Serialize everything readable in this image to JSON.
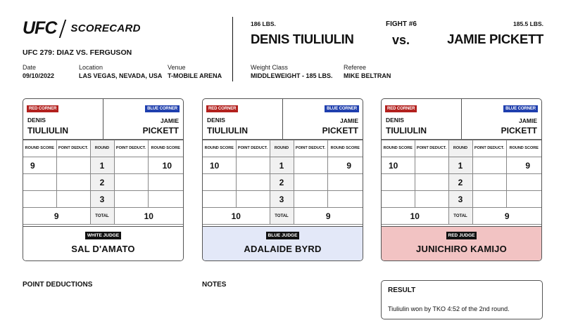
{
  "brand": {
    "logo": "UFC",
    "section": "SCORECARD"
  },
  "event": {
    "name": "UFC 279: DIAZ VS. FERGUSON",
    "date_label": "Date",
    "date": "09/10/2022",
    "location_label": "Location",
    "location": "LAS VEGAS, NEVADA, USA",
    "venue_label": "Venue",
    "venue": "T-MOBILE ARENA"
  },
  "fight": {
    "number": "FIGHT #6",
    "vs": "vs.",
    "red": {
      "weight": "186 LBS.",
      "name": "DENIS TIULIULIN",
      "first": "DENIS",
      "last": "TIULIULIN"
    },
    "blue": {
      "weight": "185.5 LBS.",
      "name": "JAMIE PICKETT",
      "first": "JAMIE",
      "last": "PICKETT"
    },
    "weight_class_label": "Weight Class",
    "weight_class": "MIDDLEWEIGHT - 185 LBS.",
    "referee_label": "Referee",
    "referee": "MIKE BELTRAN"
  },
  "labels": {
    "red_corner": "RED CORNER",
    "blue_corner": "BLUE CORNER",
    "round_score": "ROUND SCORE",
    "point_deduct": "POINT DEDUCT.",
    "round": "ROUND",
    "total": "TOTAL",
    "rounds": [
      "1",
      "2",
      "3"
    ]
  },
  "cards": [
    {
      "judge_label": "WHITE JUDGE",
      "judge": "SAL D'AMATO",
      "red_scores": [
        "9",
        "",
        ""
      ],
      "blue_scores": [
        "10",
        "",
        ""
      ],
      "red_total": "9",
      "blue_total": "10"
    },
    {
      "judge_label": "BLUE JUDGE",
      "judge": "ADALAIDE BYRD",
      "red_scores": [
        "10",
        "",
        ""
      ],
      "blue_scores": [
        "9",
        "",
        ""
      ],
      "red_total": "10",
      "blue_total": "9"
    },
    {
      "judge_label": "RED JUDGE",
      "judge": "JUNICHIRO KAMIJO",
      "red_scores": [
        "10",
        "",
        ""
      ],
      "blue_scores": [
        "9",
        "",
        ""
      ],
      "red_total": "10",
      "blue_total": "9"
    }
  ],
  "point_deductions_title": "POINT DEDUCTIONS",
  "notes_title": "NOTES",
  "result": {
    "title": "RESULT",
    "text": "Tiuliulin won by TKO 4:52 of the 2nd round."
  },
  "colors": {
    "red_corner": "#b3211e",
    "blue_corner": "#1f3fae",
    "blue_judge_bg": "#e3e8f8",
    "red_judge_bg": "#f2c3c3"
  }
}
